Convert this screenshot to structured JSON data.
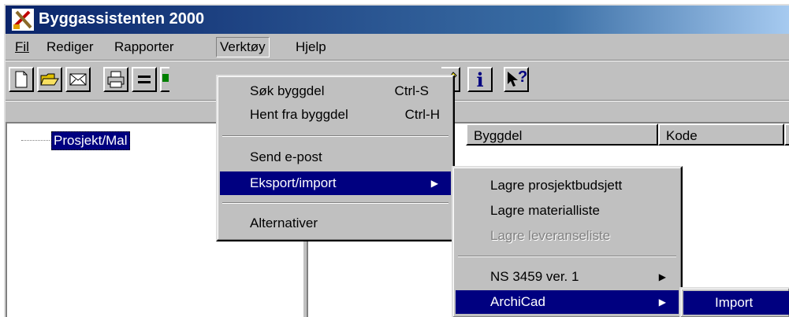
{
  "app": {
    "title": "Byggassistenten 2000"
  },
  "menubar": {
    "items": [
      {
        "label": "Fil"
      },
      {
        "label": "Rediger"
      },
      {
        "label": "Rapporter"
      },
      {
        "label": "Verktøy"
      },
      {
        "label": "Hjelp"
      }
    ]
  },
  "toolbar": {
    "info_glyph": "i",
    "help_glyph": "?"
  },
  "tree": {
    "root_label": "Prosjekt/Mal"
  },
  "list": {
    "columns": [
      "Byggdel",
      "Kode"
    ]
  },
  "verktoy_menu": {
    "items": [
      {
        "label": "Søk byggdel",
        "shortcut": "Ctrl-S"
      },
      {
        "label": "Hent fra byggdel",
        "shortcut": "Ctrl-H"
      },
      {
        "label": "Send e-post"
      },
      {
        "label": "Eksport/import"
      },
      {
        "label": "Alternativer"
      }
    ]
  },
  "eksport_menu": {
    "items": [
      {
        "label": "Lagre prosjektbudsjett"
      },
      {
        "label": "Lagre materialliste"
      },
      {
        "label": "Lagre leveranseliste",
        "disabled": true
      },
      {
        "label": "NS 3459 ver. 1"
      },
      {
        "label": "ArchiCad"
      }
    ]
  },
  "archicad_menu": {
    "items": [
      {
        "label": "Import"
      }
    ]
  }
}
